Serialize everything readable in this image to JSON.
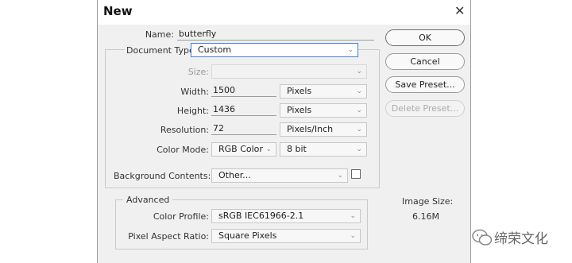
{
  "dialog": {
    "title": "New",
    "close_glyph": "✕",
    "name_label": "Name:",
    "name_value": "butterfly",
    "document_type_label": "Document Type:",
    "document_type_value": "Custom",
    "size_label": "Size:",
    "size_value": "",
    "width_label": "Width:",
    "width_value": "1500",
    "width_unit": "Pixels",
    "height_label": "Height:",
    "height_value": "1436",
    "height_unit": "Pixels",
    "resolution_label": "Resolution:",
    "resolution_value": "72",
    "resolution_unit": "Pixels/Inch",
    "color_mode_label": "Color Mode:",
    "color_mode_value": "RGB Color",
    "bit_depth_value": "8 bit",
    "background_label": "Background Contents:",
    "background_value": "Other...",
    "background_color": "#ffffff",
    "advanced_label": "Advanced",
    "color_profile_label": "Color Profile:",
    "color_profile_value": "sRGB IEC61966-2.1",
    "pixel_aspect_label": "Pixel Aspect Ratio:",
    "pixel_aspect_value": "Square Pixels"
  },
  "buttons": {
    "ok": "OK",
    "cancel": "Cancel",
    "save_preset": "Save Preset...",
    "delete_preset": "Delete Preset..."
  },
  "image_size": {
    "label": "Image Size:",
    "value": "6.16M"
  },
  "watermark": {
    "text": "缔荣文化",
    "icon": "wechat-icon"
  },
  "colors": {
    "focus_border": "#3d83d6",
    "dialog_bg": "#f0f0f0"
  }
}
